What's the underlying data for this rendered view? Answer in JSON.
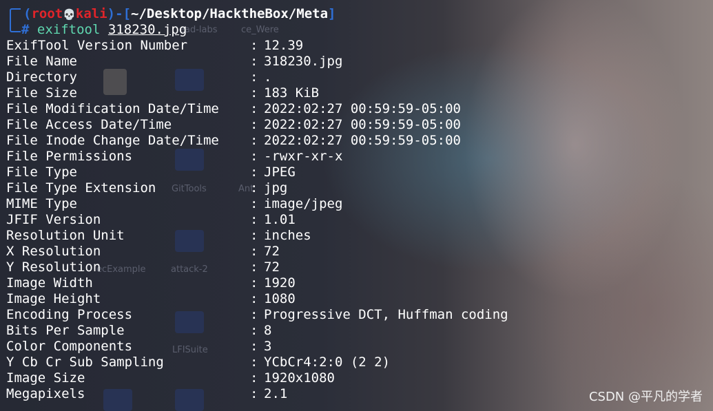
{
  "prompt": {
    "open_paren": "(",
    "user": "root",
    "skull": "💀",
    "host": "kali",
    "close_paren": ")",
    "dash": "-",
    "dir_open": "[",
    "path": "~/Desktop/HacktheBox/Meta",
    "dir_close": "]",
    "hash": "#",
    "command": "exiftool",
    "argument": "318230.jpg"
  },
  "rows": [
    {
      "key": "ExifTool Version Number",
      "value": "12.39"
    },
    {
      "key": "File Name",
      "value": "318230.jpg"
    },
    {
      "key": "Directory",
      "value": "."
    },
    {
      "key": "File Size",
      "value": "183 KiB"
    },
    {
      "key": "File Modification Date/Time",
      "value": "2022:02:27 00:59:59-05:00"
    },
    {
      "key": "File Access Date/Time",
      "value": "2022:02:27 00:59:59-05:00"
    },
    {
      "key": "File Inode Change Date/Time",
      "value": "2022:02:27 00:59:59-05:00"
    },
    {
      "key": "File Permissions",
      "value": "-rwxr-xr-x"
    },
    {
      "key": "File Type",
      "value": "JPEG"
    },
    {
      "key": "File Type Extension",
      "value": "jpg"
    },
    {
      "key": "MIME Type",
      "value": "image/jpeg"
    },
    {
      "key": "JFIF Version",
      "value": "1.01"
    },
    {
      "key": "Resolution Unit",
      "value": "inches"
    },
    {
      "key": "X Resolution",
      "value": "72"
    },
    {
      "key": "Y Resolution",
      "value": "72"
    },
    {
      "key": "Image Width",
      "value": "1920"
    },
    {
      "key": "Image Height",
      "value": "1080"
    },
    {
      "key": "Encoding Process",
      "value": "Progressive DCT, Huffman coding"
    },
    {
      "key": "Bits Per Sample",
      "value": "8"
    },
    {
      "key": "Color Components",
      "value": "3"
    },
    {
      "key": "Y Cb Cr Sub Sampling",
      "value": "YCbCr4:2:0 (2 2)"
    },
    {
      "key": "Image Size",
      "value": "1920x1080"
    },
    {
      "key": "Megapixels",
      "value": "2.1"
    }
  ],
  "separator": ":",
  "desktop_labels": [
    "ead-labs",
    "ce_Were",
    "GitTools",
    "Ant",
    "ecExample",
    "attack-2",
    "LFISuite"
  ],
  "watermark": "CSDN @平凡的学者",
  "colors": {
    "frame": "#2f6fd6",
    "user_host": "#e0242a",
    "command": "#5fd7af",
    "text": "#ffffff"
  }
}
